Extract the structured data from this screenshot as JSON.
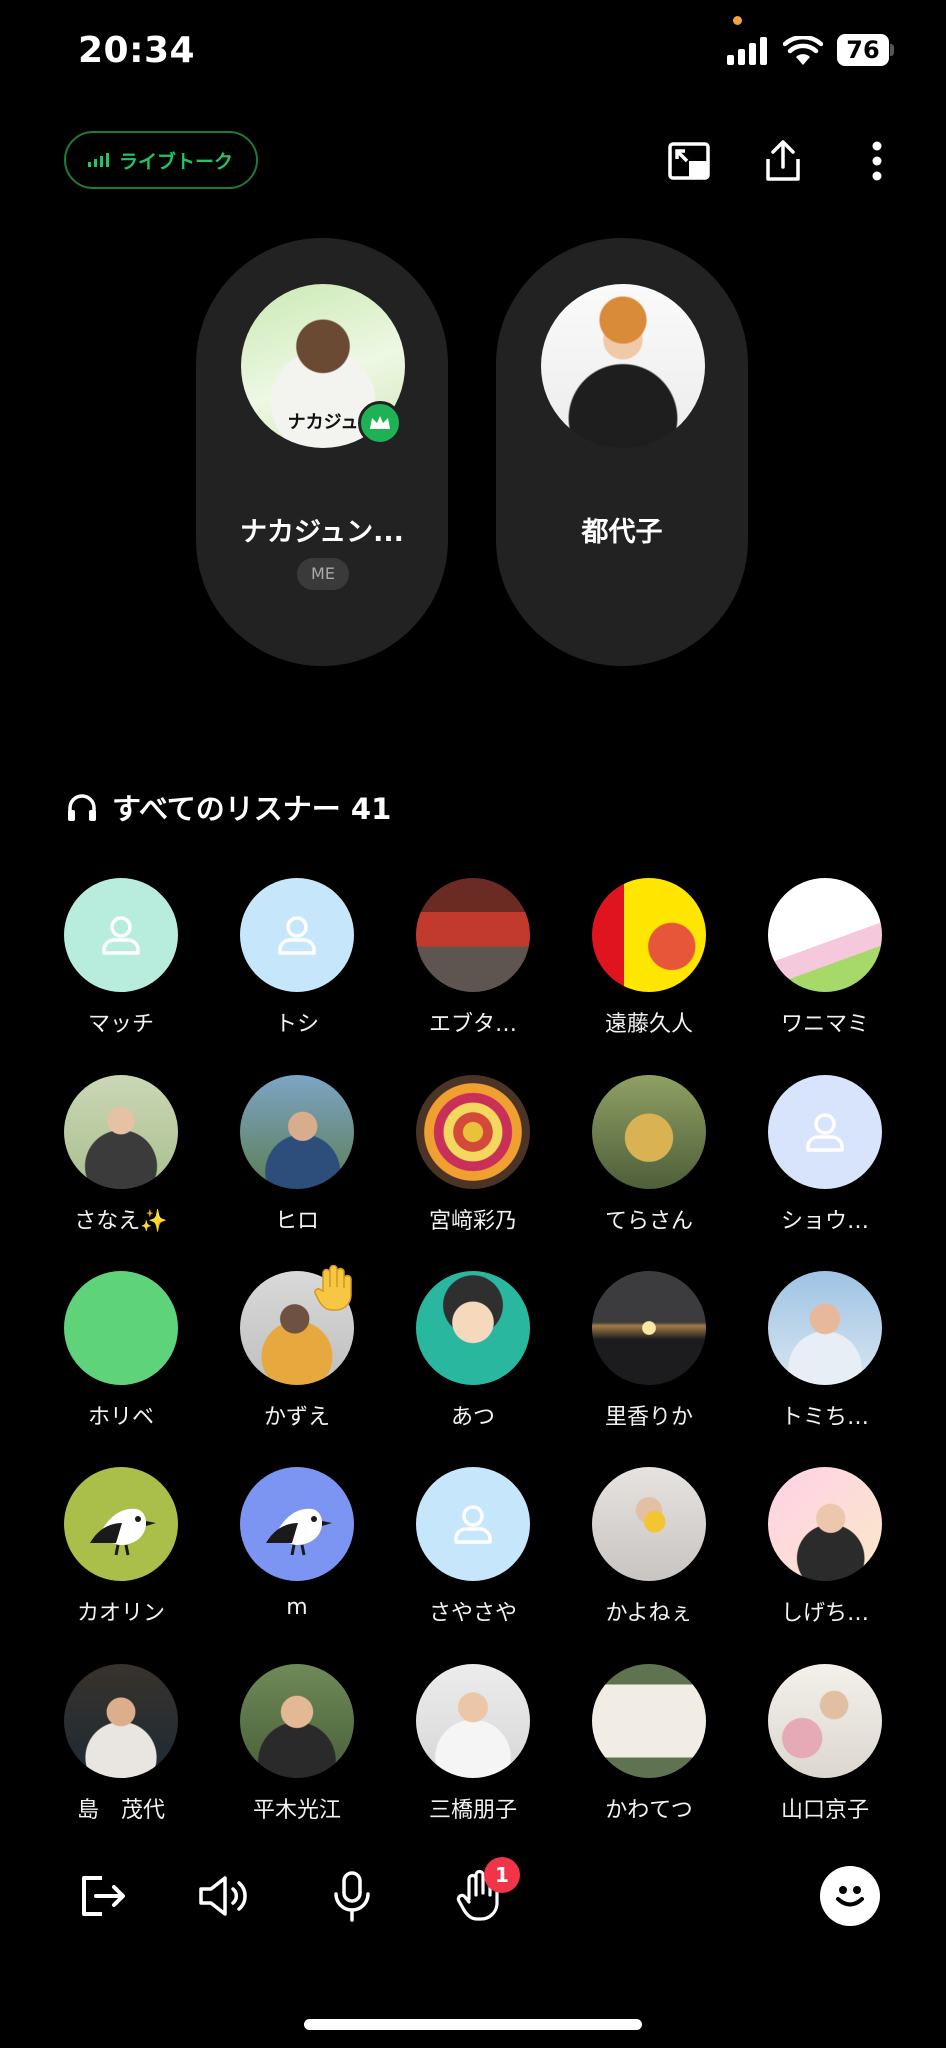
{
  "status": {
    "time": "20:34",
    "battery": "76"
  },
  "header": {
    "live_label": "ライブトーク",
    "accent": "#22c55e",
    "buttons": [
      "minimize-icon",
      "share-icon",
      "more-icon"
    ]
  },
  "speakers": [
    {
      "name": "ナカジュン...",
      "badge": "ME",
      "avatar_tag": "ナカジュ",
      "host": true
    },
    {
      "name": "都代子"
    }
  ],
  "listeners": {
    "title": "すべてのリスナー 41",
    "items": [
      {
        "name": "マッチ",
        "avatar": "default"
      },
      {
        "name": "トシ",
        "avatar": "default"
      },
      {
        "name": "エブタ…",
        "avatar": "photo"
      },
      {
        "name": "遠藤久人",
        "avatar": "photo"
      },
      {
        "name": "ワニマミ",
        "avatar": "illustration"
      },
      {
        "name": "さなえ✨",
        "avatar": "photo"
      },
      {
        "name": "ヒロ",
        "avatar": "photo"
      },
      {
        "name": "宮﨑彩乃",
        "avatar": "photo"
      },
      {
        "name": "てらさん",
        "avatar": "photo"
      },
      {
        "name": "ショウ…",
        "avatar": "default"
      },
      {
        "name": "ホリベ",
        "avatar": "illustration"
      },
      {
        "name": "かずえ",
        "avatar": "photo",
        "raised_hand": true
      },
      {
        "name": "あつ",
        "avatar": "illustration"
      },
      {
        "name": "里香りか",
        "avatar": "photo"
      },
      {
        "name": "トミち…",
        "avatar": "photo"
      },
      {
        "name": "カオリン",
        "avatar": "bird"
      },
      {
        "name": "m",
        "avatar": "bird"
      },
      {
        "name": "さやさや",
        "avatar": "default"
      },
      {
        "name": "かよねぇ",
        "avatar": "photo"
      },
      {
        "name": "しげち…",
        "avatar": "photo"
      },
      {
        "name": "島　茂代",
        "avatar": "photo"
      },
      {
        "name": "平木光江",
        "avatar": "photo"
      },
      {
        "name": "三橋朋子",
        "avatar": "photo"
      },
      {
        "name": "かわてつ",
        "avatar": "photo"
      },
      {
        "name": "山口京子",
        "avatar": "photo"
      }
    ]
  },
  "bottom_bar": {
    "buttons": [
      "leave-icon",
      "speaker-icon",
      "mic-icon",
      "raise-hand-icon",
      "emoji-icon"
    ],
    "hand_badge_count": "1"
  }
}
